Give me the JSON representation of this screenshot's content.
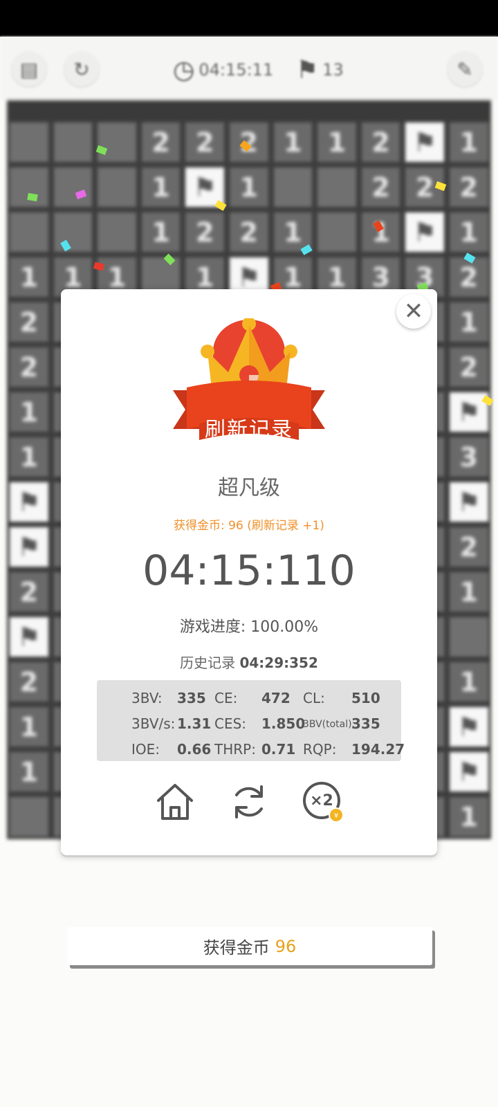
{
  "toolbar": {
    "timer": "04:15:11",
    "flags": "13"
  },
  "board": {
    "rows": [
      [
        "",
        "",
        "",
        "2",
        "2",
        "2",
        "1",
        "1",
        "2",
        "F",
        "1"
      ],
      [
        "",
        "",
        "",
        "1",
        "F",
        "1",
        "",
        "",
        "2",
        "2",
        "2"
      ],
      [
        "",
        "",
        "",
        "1",
        "2",
        "2",
        "1",
        "",
        "1",
        "F",
        "1"
      ],
      [
        "1",
        "1",
        "1",
        "",
        "1",
        "F",
        "1",
        "1",
        "3",
        "3",
        "2"
      ],
      [
        "2",
        "",
        "",
        "",
        "",
        "",
        "",
        "",
        "",
        "",
        "1"
      ],
      [
        "2",
        "",
        "",
        "",
        "",
        "",
        "",
        "",
        "",
        "",
        "2"
      ],
      [
        "1",
        "",
        "",
        "",
        "",
        "",
        "",
        "",
        "",
        "",
        "F"
      ],
      [
        "1",
        "",
        "",
        "",
        "",
        "",
        "",
        "",
        "",
        "",
        "3"
      ],
      [
        "F",
        "",
        "",
        "",
        "",
        "",
        "",
        "",
        "",
        "",
        "F"
      ],
      [
        "F",
        "",
        "",
        "",
        "",
        "",
        "",
        "",
        "",
        "",
        "2"
      ],
      [
        "2",
        "",
        "",
        "",
        "",
        "",
        "",
        "",
        "",
        "",
        "1"
      ],
      [
        "F",
        "",
        "",
        "",
        "",
        "",
        "",
        "",
        "",
        "",
        ""
      ],
      [
        "2",
        "",
        "",
        "",
        "",
        "",
        "",
        "",
        "",
        "",
        "1"
      ],
      [
        "1",
        "",
        "",
        "",
        "",
        "",
        "",
        "",
        "",
        "",
        "F"
      ],
      [
        "1",
        "",
        "",
        "",
        "",
        "",
        "",
        "",
        "",
        "",
        "F"
      ],
      [
        "",
        "",
        "",
        "",
        "",
        "",
        "",
        "",
        "",
        "",
        "1"
      ]
    ]
  },
  "dialog": {
    "banner": "刷新记录",
    "rank": "超凡级",
    "coins_line": "获得金币: 96 (刷新记录 +1)",
    "time": "04:15:110",
    "progress_label": "游戏进度:",
    "progress_value": "100.00%",
    "history_label": "历史记录",
    "history_value": "04:29:352",
    "stats": {
      "bv_label": "3BV:",
      "bv": "335",
      "ce_label": "CE:",
      "ce": "472",
      "cl_label": "CL:",
      "cl": "510",
      "bvs_label": "3BV/s:",
      "bvs": "1.31",
      "ces_label": "CES:",
      "ces": "1.850",
      "bvt_label": "3BV(total):",
      "bvt": "335",
      "ioe_label": "IOE:",
      "ioe": "0.66",
      "thrp_label": "THRP:",
      "thrp": "0.71",
      "rqp_label": "RQP:",
      "rqp": "194.27"
    },
    "double_label": "×2"
  },
  "bottom": {
    "coins_label": "获得金币",
    "coins_value": "96"
  },
  "colors": {
    "accent_orange": "#f0902a",
    "coin_gold": "#e6a21c",
    "banner_red": "#e8431c",
    "crown_yellow": "#f6b624"
  }
}
